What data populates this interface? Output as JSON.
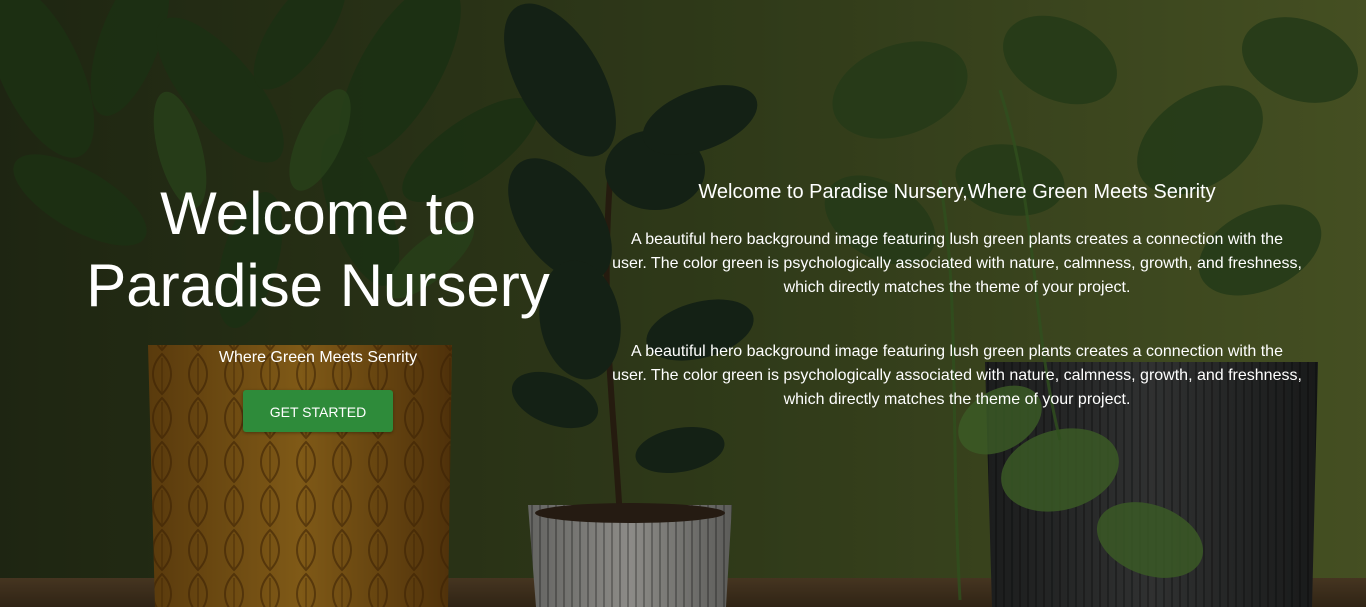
{
  "hero": {
    "title_line1": "Welcome to",
    "title_line2": "Paradise Nursery",
    "subtitle": "Where Green Meets Senrity",
    "cta_label": "GET STARTED"
  },
  "about": {
    "heading": "Welcome to Paradise Nursery,Where Green Meets Senrity",
    "paragraphs": [
      "A beautiful hero background image featuring lush green plants creates a connection with the user. The color green is psychologically associated with nature, calmness, growth, and freshness, which directly matches the theme of your project.",
      "A beautiful hero background image featuring lush green plants creates a connection with the user. The color green is psychologically associated with nature, calmness, growth, and freshness, which directly matches the theme of your project."
    ]
  },
  "colors": {
    "cta_background": "#2e8b3a",
    "text": "#ffffff",
    "wall": "#5c6a2e"
  }
}
